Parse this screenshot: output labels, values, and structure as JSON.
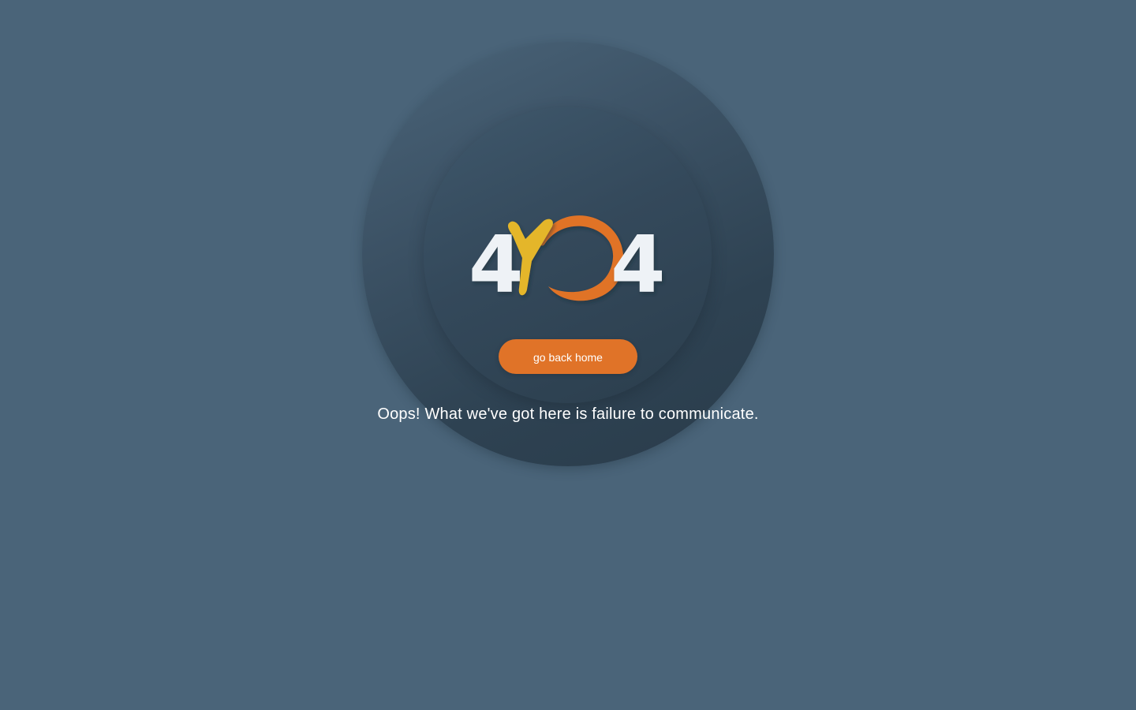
{
  "logo": {
    "digit_left": "4",
    "digit_right": "4"
  },
  "actions": {
    "home_label": "go back home"
  },
  "message": {
    "text": "Oops! What we've got here is failure to communicate."
  },
  "colors": {
    "background": "#4a6479",
    "accent_orange": "#e07328",
    "accent_yellow": "#e4b62a",
    "digit_white": "#eef2f6"
  }
}
